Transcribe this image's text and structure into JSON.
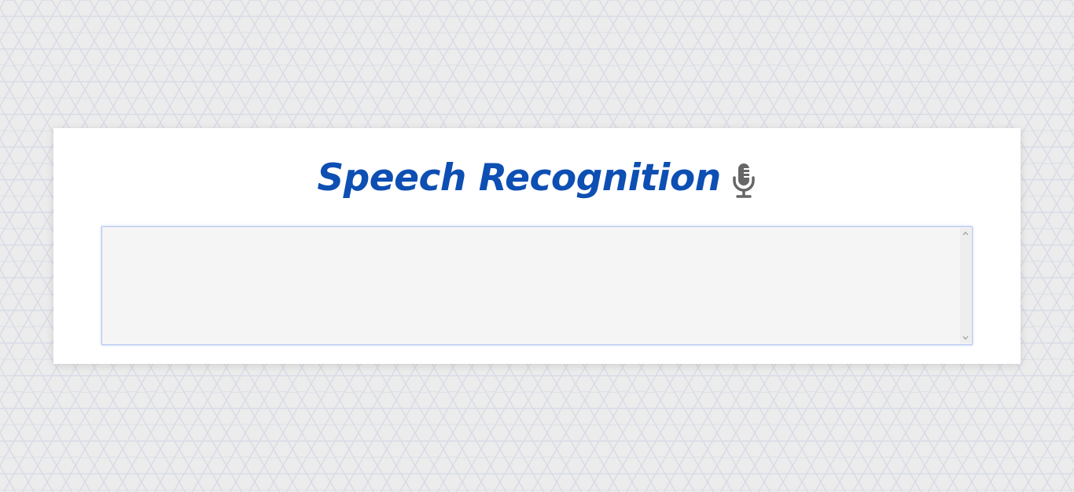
{
  "page": {
    "background_color": "#ececec",
    "pattern": "hexagon-grid"
  },
  "card": {
    "title": "Speech Recognition",
    "title_color": "#0d4fb3",
    "icon": "microphone-icon",
    "icon_color": "#666666"
  },
  "transcript": {
    "value": "",
    "placeholder": "",
    "background_color": "#f5f5f5",
    "border_color": "#b8c8f0"
  },
  "scrollbar": {
    "up_icon": "chevron-up-icon",
    "down_icon": "chevron-down-icon"
  }
}
